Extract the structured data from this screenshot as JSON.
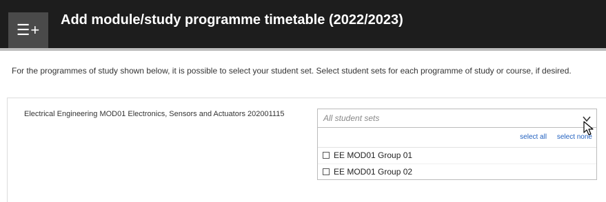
{
  "header": {
    "icon_glyph": "☰+",
    "icon_name": "menu-add-icon",
    "title": "Add module/study programme timetable (2022/2023)",
    "background_color": "#1d1d1d"
  },
  "intro": {
    "text": "For the programmes of study shown below, it is possible to select your student set. Select student sets for each programme of study or course, if desired."
  },
  "course": {
    "label": "Electrical Engineering MOD01 Electronics, Sensors and Actuators 202001115",
    "select": {
      "placeholder": "All student sets",
      "expanded": true
    },
    "dropdown": {
      "select_all": "select all",
      "select_none": "select none",
      "options": [
        {
          "label": "EE MOD01 Group 01",
          "checked": false
        },
        {
          "label": "EE MOD01 Group 02",
          "checked": false
        }
      ]
    }
  },
  "colors": {
    "link": "#1f5fbf",
    "border": "#bbbbbb"
  }
}
